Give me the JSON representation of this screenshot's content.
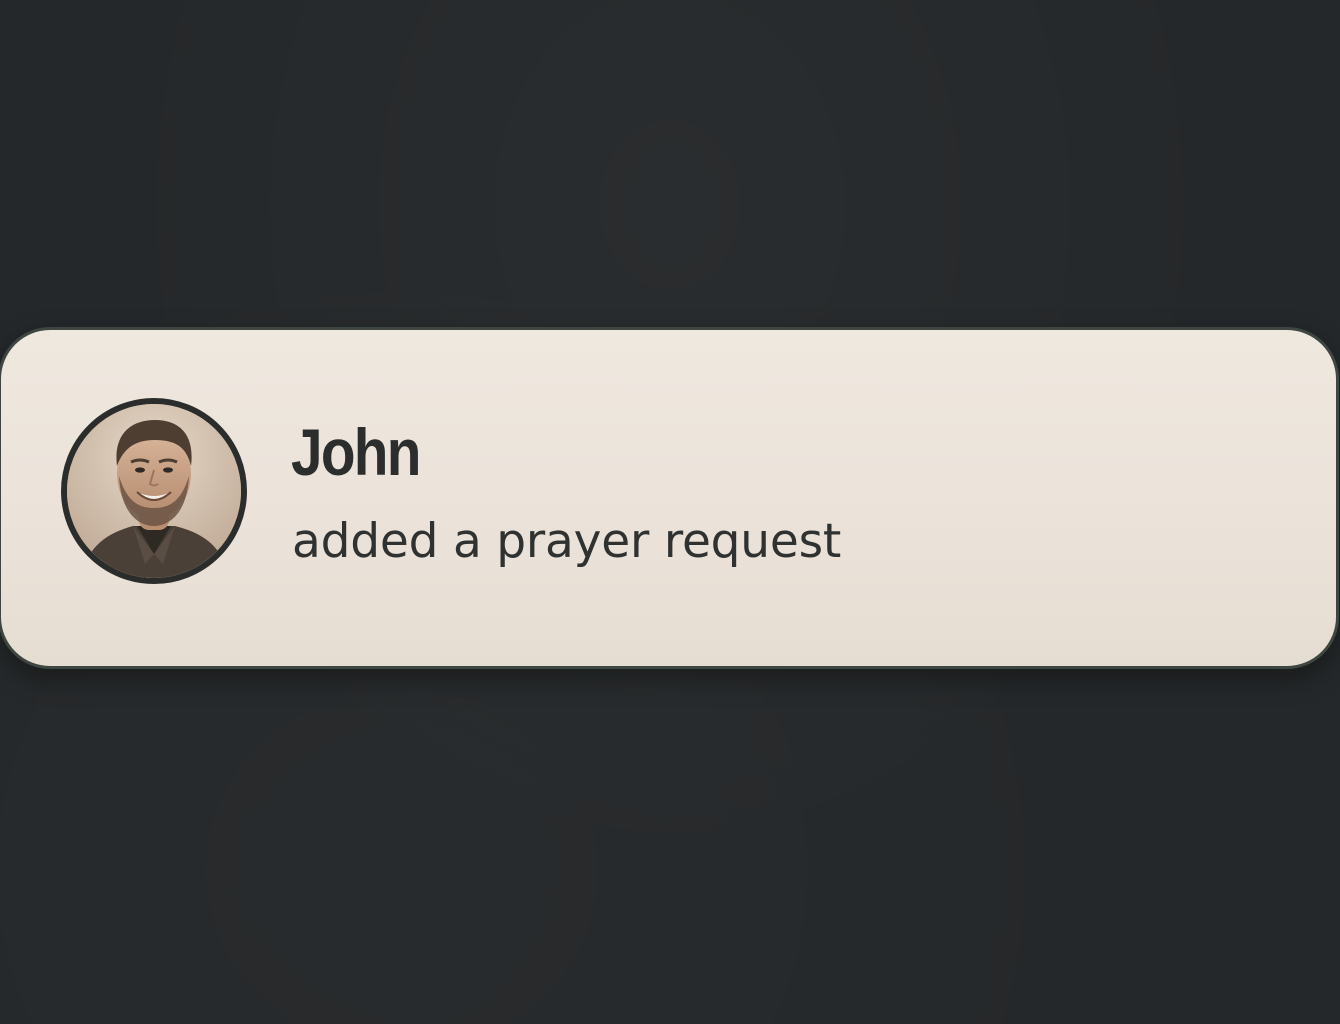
{
  "notification": {
    "user_name": "John",
    "action_text": "added a prayer request",
    "avatar_icon": "user-avatar-photo"
  },
  "colors": {
    "background": "#25282a",
    "card": "#ebe3da",
    "card_border": "#3d4640",
    "text": "#2b2e2c"
  }
}
